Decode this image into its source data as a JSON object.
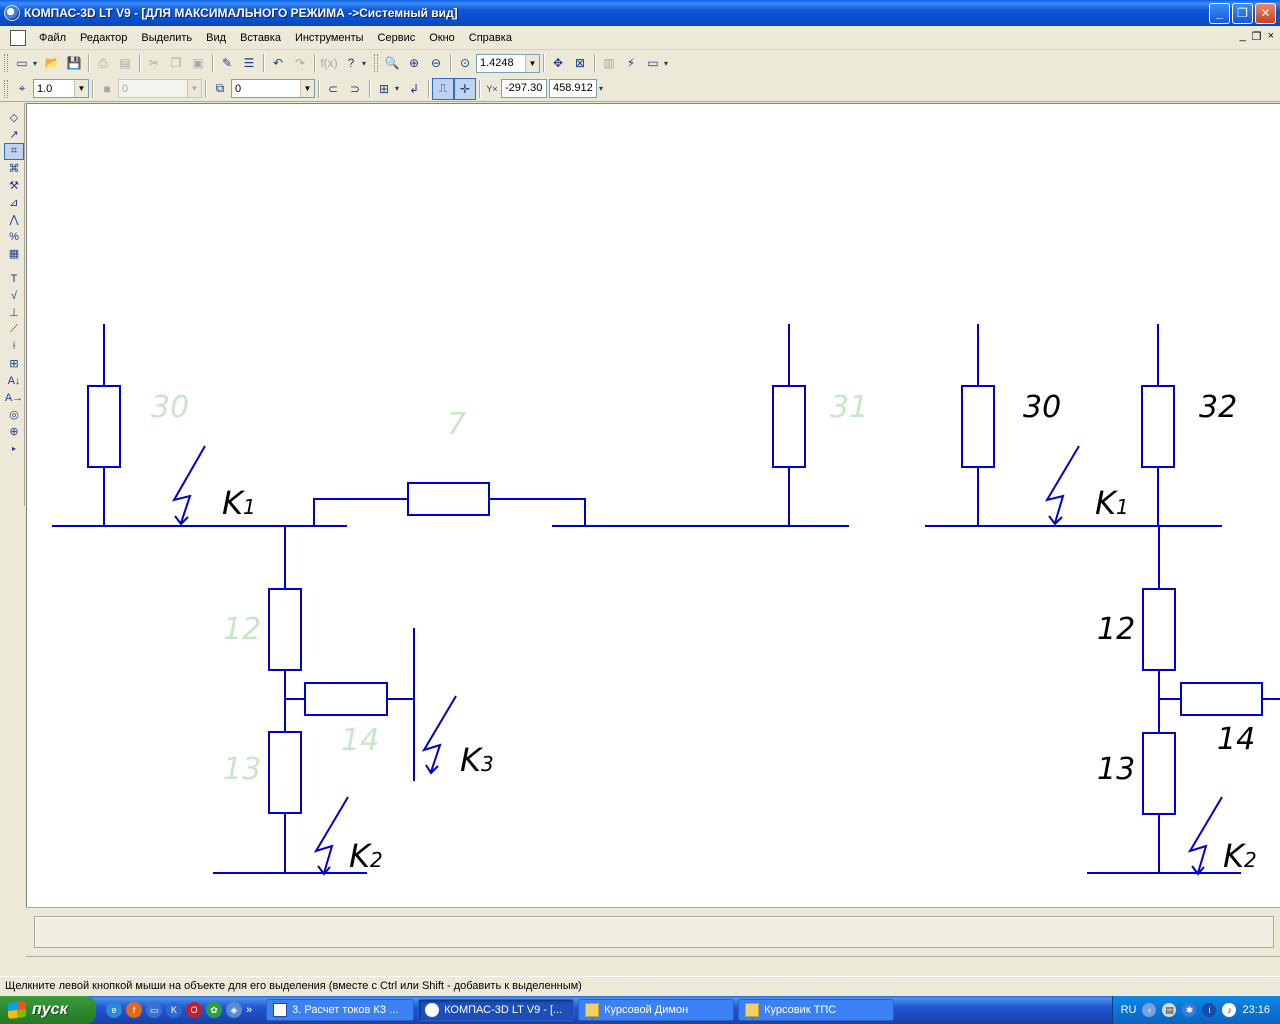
{
  "window": {
    "title": "КОМПАС-3D LT V9 - [ДЛЯ МАКСИМАЛЬНОГО РЕЖИМА ->Системный вид]",
    "minimize_label": "_",
    "maximize_label": "❐",
    "close_label": "✕"
  },
  "menu": {
    "items": [
      "Файл",
      "Редактор",
      "Выделить",
      "Вид",
      "Вставка",
      "Инструменты",
      "Сервис",
      "Окно",
      "Справка"
    ],
    "mdi_minimize": "_",
    "mdi_restore": "❐",
    "mdi_close": "×"
  },
  "toolbar": {
    "zoom_value": "1.4248"
  },
  "toolbar2": {
    "line_style_value": "1.0",
    "layer_value": "0",
    "level_value": "0",
    "coord_label": "Y×",
    "coord_x": "-297.30",
    "coord_y": "458.912"
  },
  "drawing": {
    "left_scheme": {
      "resistor_labels": [
        "30",
        "7",
        "31",
        "12",
        "14",
        "13"
      ],
      "fault_labels": [
        "K",
        "K",
        "K"
      ],
      "fault_subscripts": [
        "1",
        "2",
        "3"
      ]
    },
    "right_scheme": {
      "resistor_labels": [
        "30",
        "32",
        "12",
        "14",
        "13"
      ],
      "fault_labels": [
        "K",
        "K"
      ],
      "fault_subscripts": [
        "1",
        "2"
      ]
    },
    "colors": {
      "line": "#0000c8",
      "faded_label": "#c8e6c8",
      "label": "#000000"
    }
  },
  "status": {
    "hint": "Щелкните левой кнопкой мыши на объекте для его выделения (вместе с Ctrl или Shift - добавить к выделенным)"
  },
  "taskbar": {
    "start_label": "пуск",
    "more_label": "»",
    "tasks": [
      {
        "label": "3. Расчет токов КЗ ...",
        "icon": "word-icon"
      },
      {
        "label": "КОМПАС-3D LT V9 - [...",
        "icon": "kompas-icon"
      },
      {
        "label": "Курсовой Димон",
        "icon": "folder-icon"
      },
      {
        "label": "Курсовик ТПС",
        "icon": "folder-icon"
      }
    ],
    "language": "RU",
    "clock": "23:16"
  }
}
